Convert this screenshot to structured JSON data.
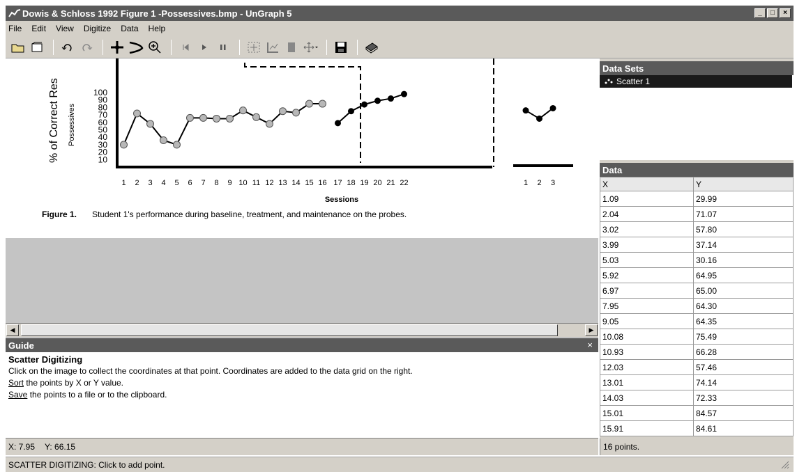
{
  "window": {
    "title": "Dowis & Schloss 1992 Figure 1 -Possessives.bmp - UnGraph 5",
    "buttons": [
      "_",
      "□",
      "×"
    ]
  },
  "menu": [
    "File",
    "Edit",
    "View",
    "Digitize",
    "Data",
    "Help"
  ],
  "figure": {
    "y_axis_label": "% of Correct Res",
    "y_axis_sublabel": "Possessives",
    "x_axis_label": "Sessions",
    "caption_label": "Figure 1.",
    "caption_text": "Student 1's performance during baseline, treatment, and maintenance on the probes."
  },
  "chart_data": {
    "type": "line",
    "ylim": [
      0,
      100
    ],
    "yticks": [
      10,
      20,
      30,
      40,
      50,
      60,
      70,
      80,
      90,
      100
    ],
    "xticks": [
      "1",
      "2",
      "3",
      "4",
      "5",
      "6",
      "7",
      "8",
      "9",
      "10",
      "11",
      "12",
      "13",
      "14",
      "15",
      "16",
      "17",
      "18",
      "19",
      "20",
      "21",
      "22",
      "1",
      "2",
      "3"
    ],
    "series": [
      {
        "phase": "baseline",
        "x": [
          1,
          2,
          3,
          4,
          5,
          6,
          7,
          8,
          9,
          10,
          11,
          12,
          13,
          14,
          15,
          16
        ],
        "y": [
          30,
          72,
          58,
          36,
          30,
          66,
          66,
          65,
          65,
          76,
          67,
          58,
          75,
          73,
          85,
          85
        ],
        "color": "#b8b8b8"
      },
      {
        "phase": "treatment",
        "x": [
          17,
          18,
          19,
          20,
          21,
          22
        ],
        "y": [
          59,
          75,
          84,
          89,
          92,
          98
        ],
        "color": "#000000"
      },
      {
        "phase": "maintenance",
        "x": [
          1,
          2,
          3
        ],
        "y": [
          76,
          65,
          79
        ],
        "color": "#000000"
      }
    ],
    "grid": false
  },
  "guide": {
    "header": "Guide",
    "close": "×",
    "heading": "Scatter Digitizing",
    "line1": "Click on the image to collect the coordinates at that point. Coordinates are added to the data grid on the right.",
    "sort_link": "Sort",
    "sort_rest": " the points by X or Y value.",
    "save_link": "Save",
    "save_rest": " the points to a file or to the clipboard."
  },
  "datasets": {
    "header": "Data Sets",
    "items": [
      "Scatter 1"
    ]
  },
  "data_grid": {
    "header": "Data",
    "columns": [
      "X",
      "Y"
    ],
    "rows": [
      [
        "1.09",
        "29.99"
      ],
      [
        "2.04",
        "71.07"
      ],
      [
        "3.02",
        "57.80"
      ],
      [
        "3.99",
        "37.14"
      ],
      [
        "5.03",
        "30.16"
      ],
      [
        "5.92",
        "64.95"
      ],
      [
        "6.97",
        "65.00"
      ],
      [
        "7.95",
        "64.30"
      ],
      [
        "9.05",
        "64.35"
      ],
      [
        "10.08",
        "75.49"
      ],
      [
        "10.93",
        "66.28"
      ],
      [
        "12.03",
        "57.46"
      ],
      [
        "13.01",
        "74.14"
      ],
      [
        "14.03",
        "72.33"
      ],
      [
        "15.01",
        "84.57"
      ],
      [
        "15.91",
        "84.61"
      ]
    ]
  },
  "status": {
    "x_label": "X: 7.95",
    "y_label": "Y: 66.15",
    "points": "16 points.",
    "mode": "SCATTER DIGITIZING: Click to add point."
  }
}
